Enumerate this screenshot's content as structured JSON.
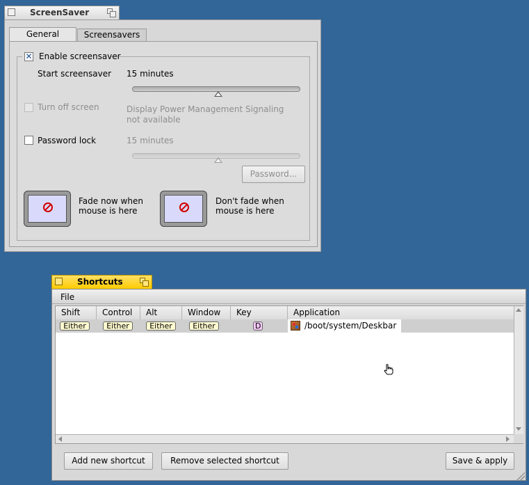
{
  "screensaver_window": {
    "title": "ScreenSaver",
    "tabs": [
      "General",
      "Screensavers"
    ],
    "enable_label": "Enable screensaver",
    "enable_checked": true,
    "start_label": "Start screensaver",
    "start_value": "15 minutes",
    "start_level": 0.5,
    "turn_off_label": "Turn off screen",
    "dpms_note_line1": "Display Power Management Signaling",
    "dpms_note_line2": "not available",
    "password_lock_label": "Password lock",
    "password_lock_value": "15 minutes",
    "password_lock_level": 0.5,
    "password_button": "Password...",
    "fade_now_line1": "Fade now when",
    "fade_now_line2": "mouse is here",
    "dont_fade_line1": "Don't fade when",
    "dont_fade_line2": "mouse is here"
  },
  "shortcuts_window": {
    "title": "Shortcuts",
    "menu": [
      "File"
    ],
    "columns": [
      "Shift",
      "Control",
      "Alt",
      "Window",
      "Key",
      "Application"
    ],
    "rows": [
      {
        "shift": "Either",
        "control": "Either",
        "alt": "Either",
        "window": "Either",
        "key": "D",
        "application": "/boot/system/Deskbar"
      }
    ],
    "buttons": {
      "add": "Add new shortcut",
      "remove": "Remove selected shortcut",
      "save": "Save & apply"
    }
  },
  "colors": {
    "desktop": "#336698",
    "active_tab": "#ffcb00",
    "inactive_tab": "#e8e8e8"
  }
}
